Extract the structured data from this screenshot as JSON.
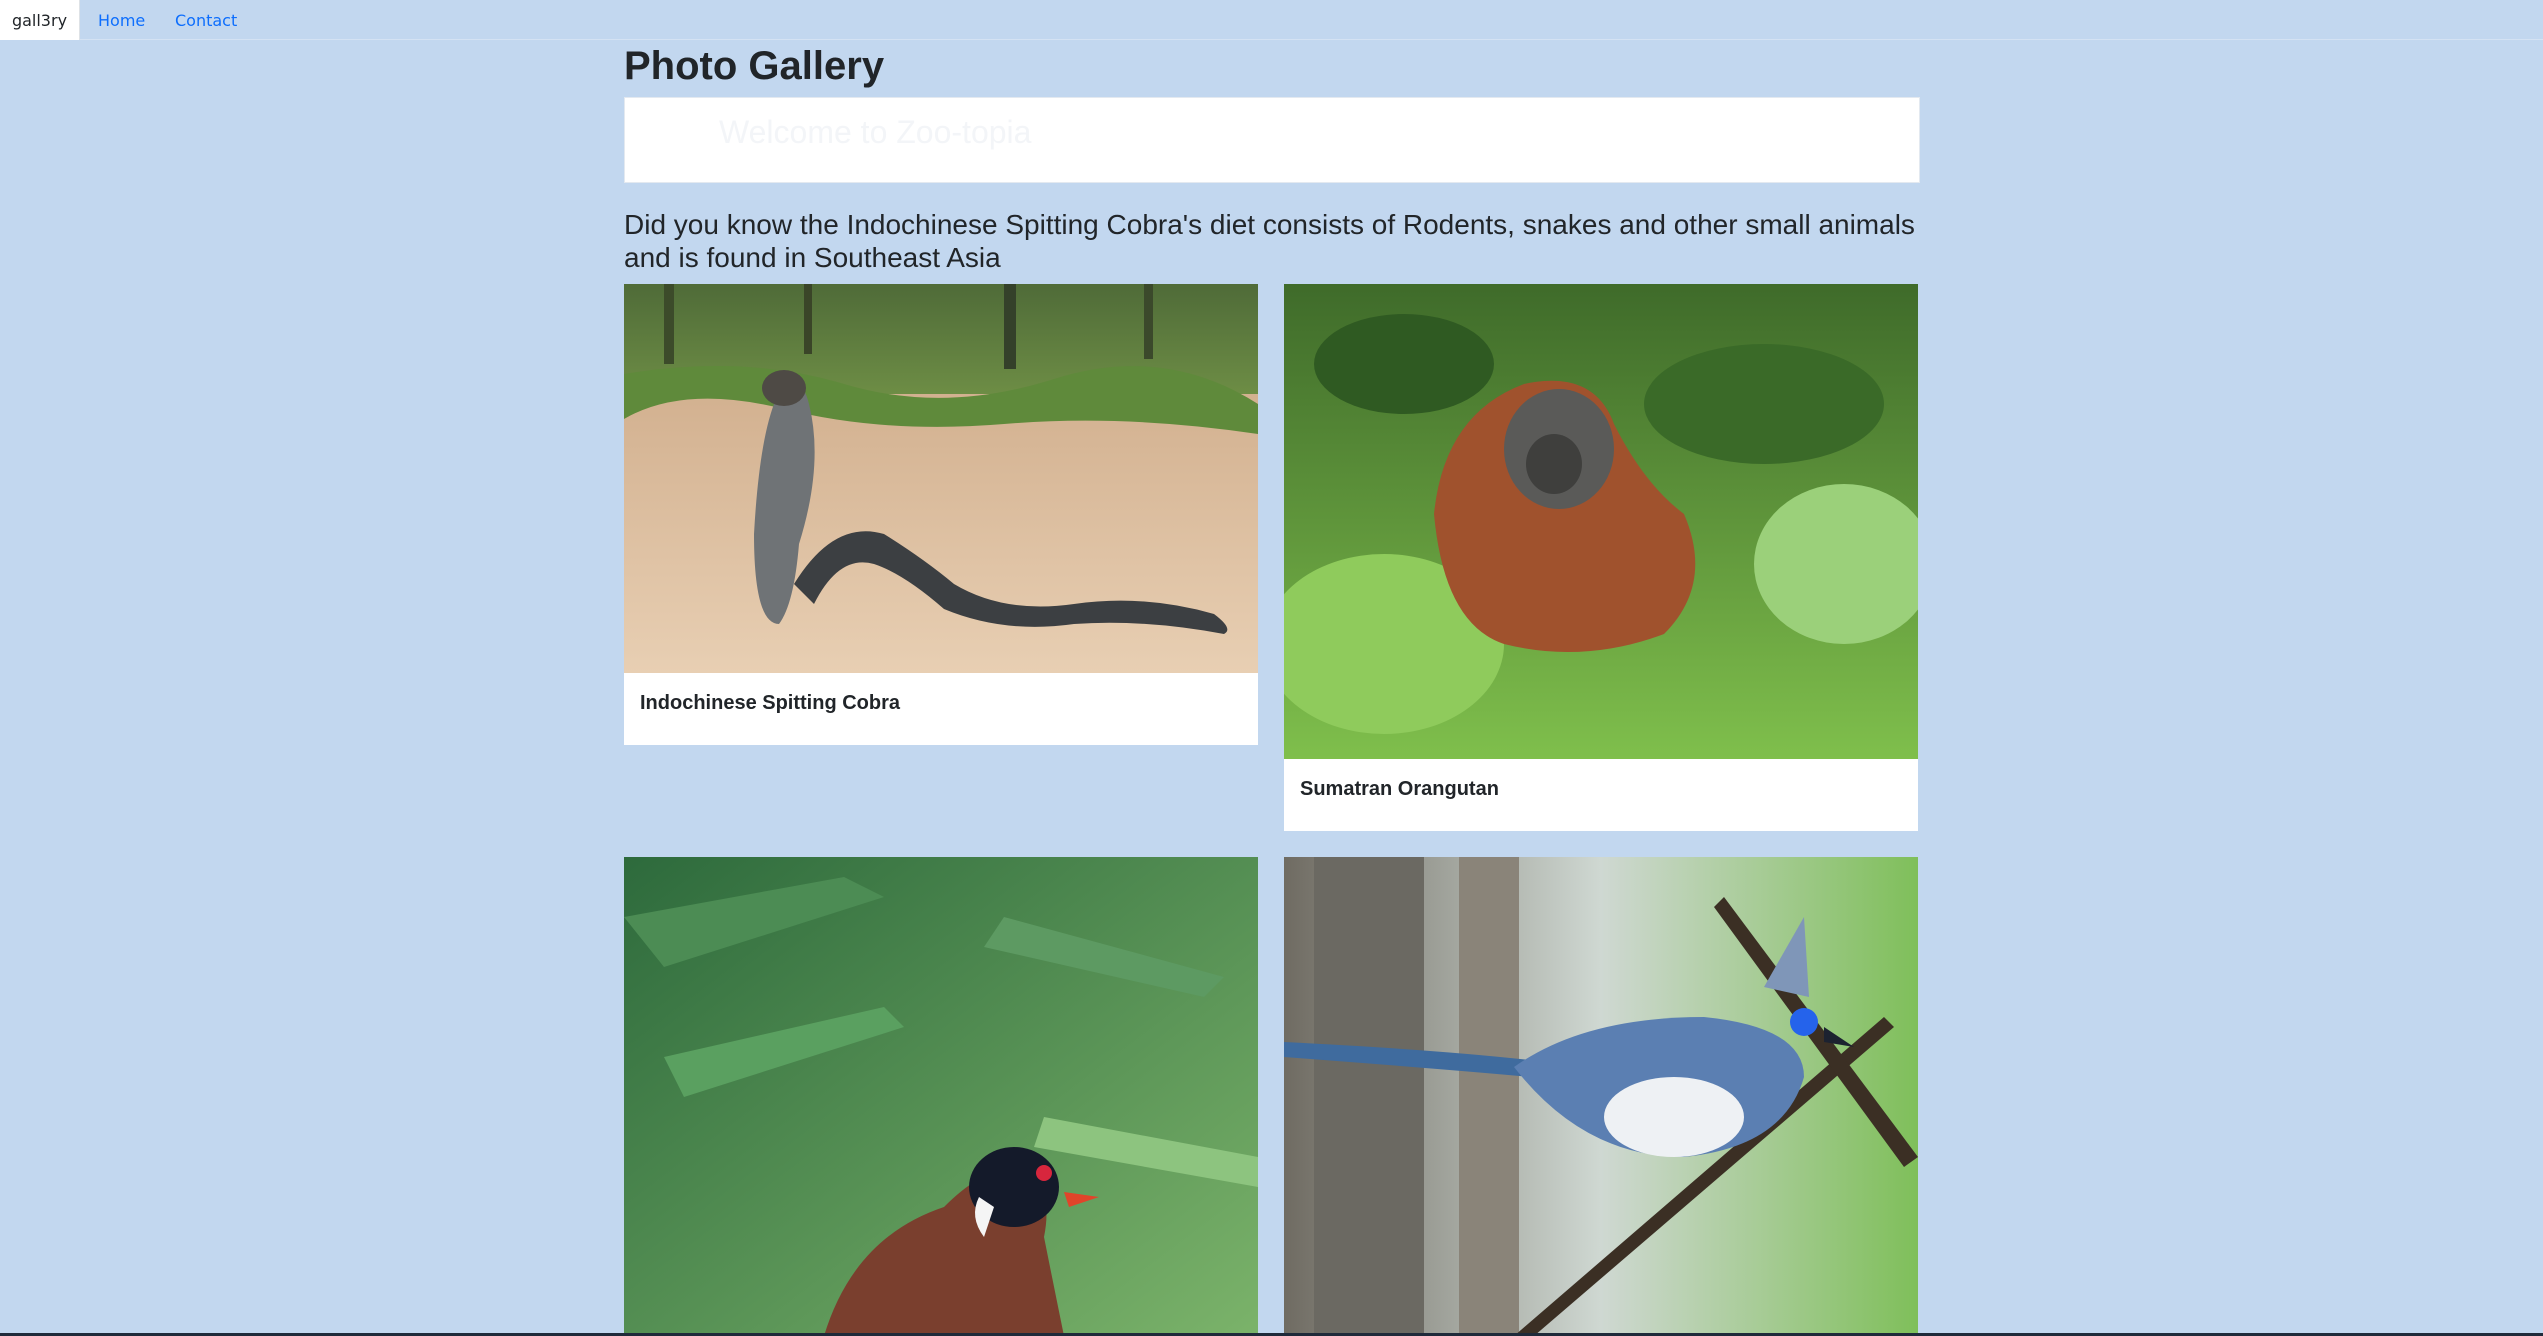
{
  "nav": {
    "brand": "gall3ry",
    "links": [
      "Home",
      "Contact"
    ]
  },
  "page": {
    "title": "Photo Gallery",
    "welcome": "Welcome to Zoo-topia",
    "fact": "Did you know the Indochinese Spitting Cobra's diet consists of Rodents, snakes and other small animals and is found in Southeast Asia"
  },
  "gallery": {
    "cards": [
      {
        "caption": "Indochinese Spitting Cobra",
        "photo": "cobra-photo"
      },
      {
        "caption": "Sumatran Orangutan",
        "photo": "orangutan-photo"
      },
      {
        "caption": "",
        "photo": "pigeon-photo"
      },
      {
        "caption": "",
        "photo": "coua-photo"
      }
    ]
  },
  "colors": {
    "page_background": "#c2d7ef",
    "link": "#0d6efd",
    "card": "#ffffff",
    "text": "#212529"
  }
}
